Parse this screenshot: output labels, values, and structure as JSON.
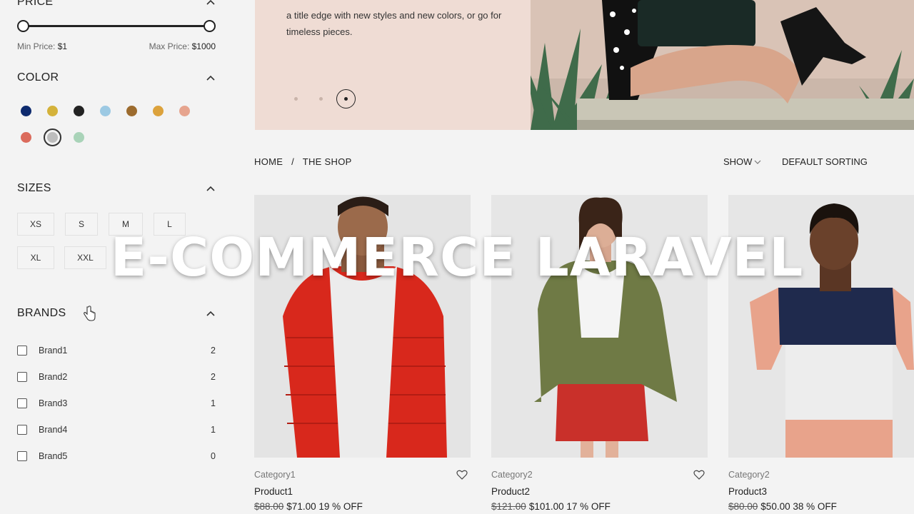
{
  "sidebar": {
    "price": {
      "title": "PRICE",
      "min_label": "Min Price:",
      "min_value": "$1",
      "max_label": "Max Price:",
      "max_value": "$1000"
    },
    "color": {
      "title": "COLOR",
      "swatches": [
        "#0d2a6e",
        "#d4b23a",
        "#222222",
        "#9cc9e3",
        "#9c6b2e",
        "#dca23c",
        "#e6a48e",
        "#db6b5c",
        "#bdbdbd",
        "#a9d3b8"
      ],
      "selected_index": 8
    },
    "sizes": {
      "title": "SIZES",
      "options": [
        "XS",
        "S",
        "M",
        "L",
        "XL",
        "XXL"
      ]
    },
    "brands": {
      "title": "BRANDS",
      "items": [
        {
          "name": "Brand1",
          "count": "2"
        },
        {
          "name": "Brand2",
          "count": "2"
        },
        {
          "name": "Brand3",
          "count": "1"
        },
        {
          "name": "Brand4",
          "count": "1"
        },
        {
          "name": "Brand5",
          "count": "0"
        }
      ]
    }
  },
  "hero": {
    "text": "a title edge with new styles and new colors, or go for timeless pieces."
  },
  "toolbar": {
    "breadcrumb_home": "HOME",
    "breadcrumb_sep": "/",
    "breadcrumb_current": "THE SHOP",
    "show_label": "SHOW",
    "sort_label": "DEFAULT SORTING"
  },
  "products": [
    {
      "category": "Category1",
      "name": "Product1",
      "old_price": "$88.00",
      "price": "$71.00",
      "discount": "19 % OFF"
    },
    {
      "category": "Category2",
      "name": "Product2",
      "old_price": "$121.00",
      "price": "$101.00",
      "discount": "17 % OFF"
    },
    {
      "category": "Category2",
      "name": "Product3",
      "old_price": "$80.00",
      "price": "$50.00",
      "discount": "38 % OFF"
    }
  ],
  "overlay": {
    "title": "E-COMMERCE LARAVEL"
  }
}
